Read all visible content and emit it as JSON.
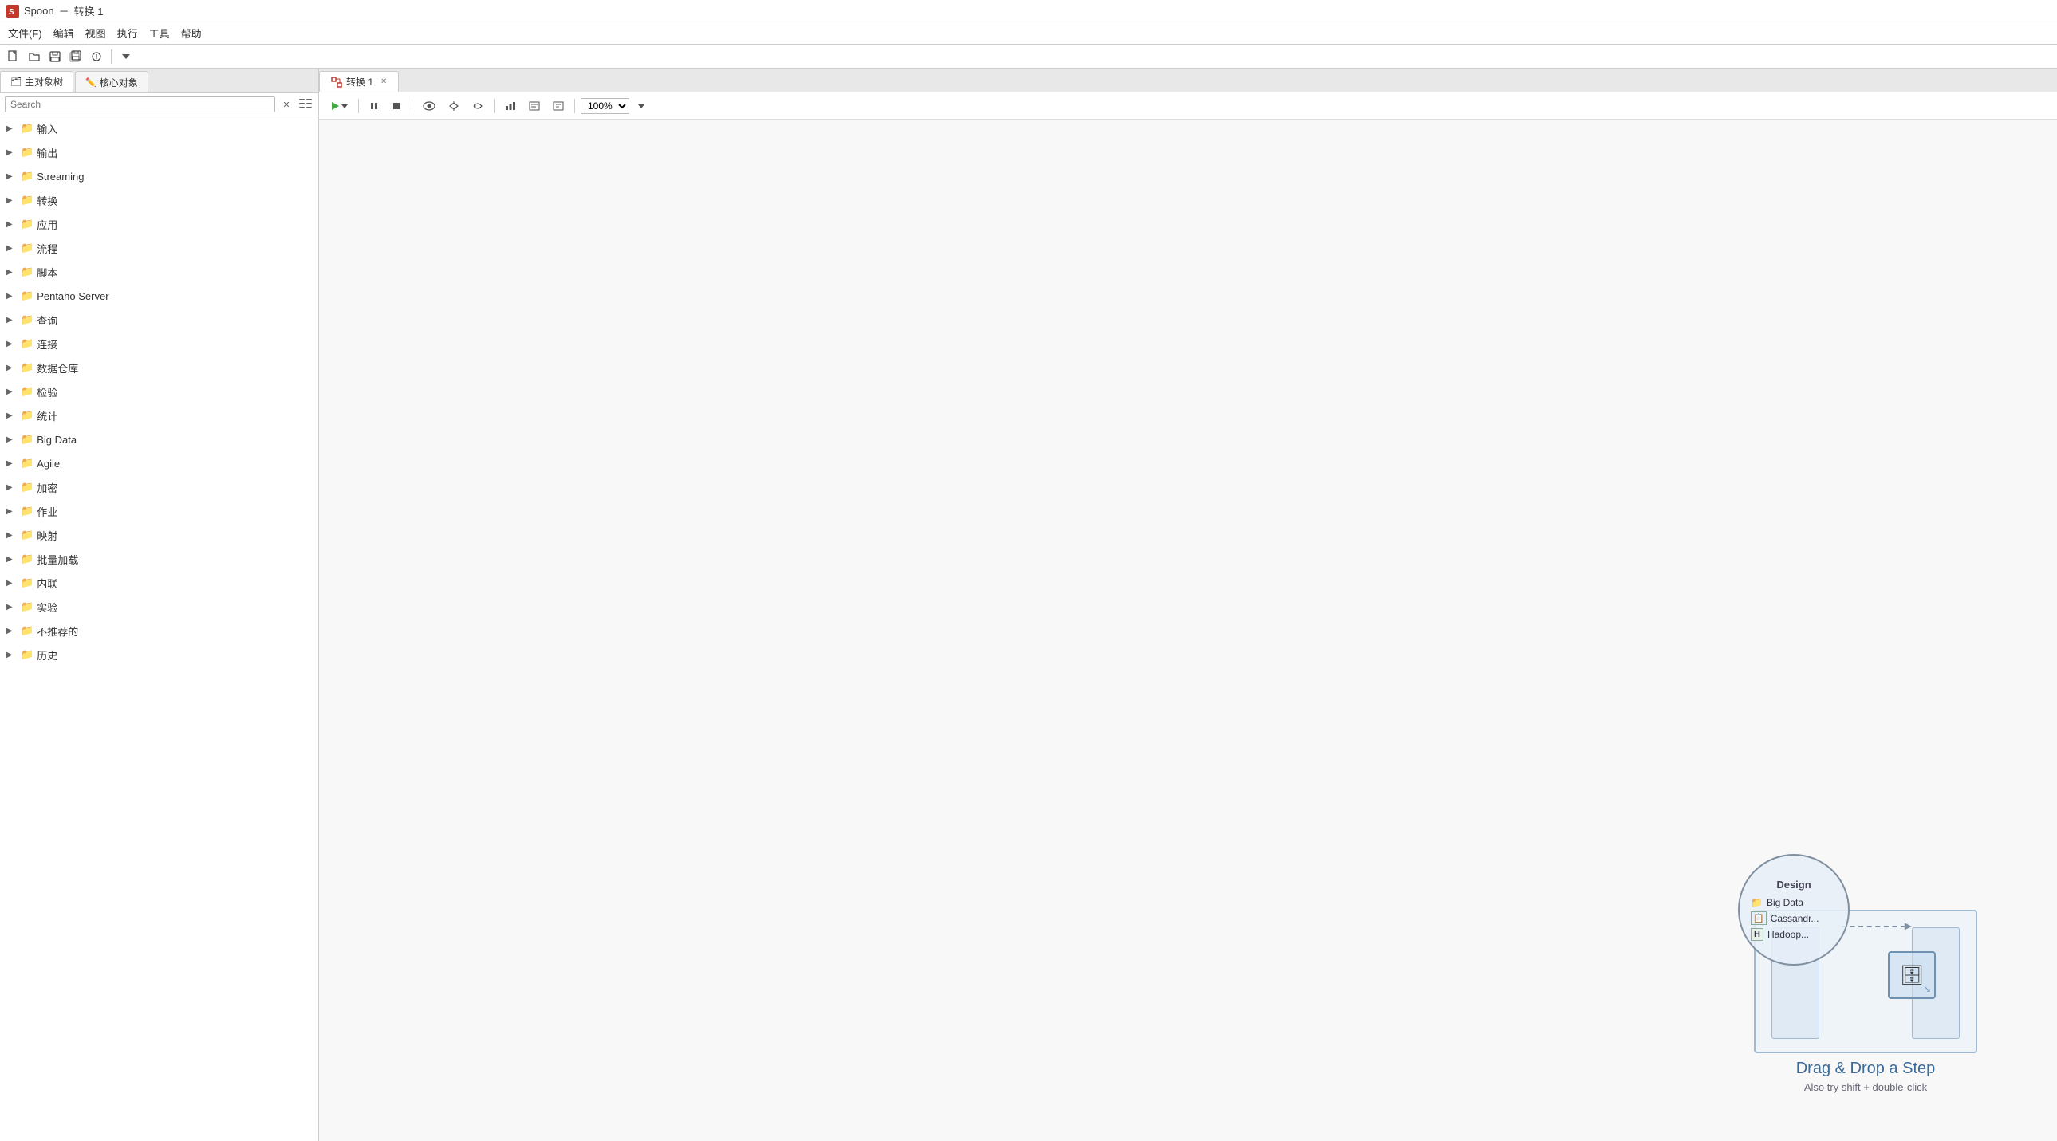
{
  "titleBar": {
    "appName": "Spoon",
    "separator": "－",
    "docName": "转换 1",
    "appIconColor": "#c0392b"
  },
  "menuBar": {
    "items": [
      {
        "label": "文件(F)"
      },
      {
        "label": "编辑"
      },
      {
        "label": "视图"
      },
      {
        "label": "执行"
      },
      {
        "label": "工具"
      },
      {
        "label": "帮助"
      }
    ]
  },
  "toolbar": {
    "buttons": [
      "📄",
      "📂",
      "💾",
      "🖨",
      "📋",
      "↩"
    ]
  },
  "leftPanel": {
    "tabs": [
      {
        "label": "主对象树",
        "icon": "🗂",
        "active": true
      },
      {
        "label": "核心对象",
        "icon": "✏️",
        "active": false
      }
    ],
    "search": {
      "placeholder": "Search",
      "clearBtn": "✕",
      "configBtn": "⚙"
    },
    "tree": [
      {
        "label": "输入",
        "arrow": "▶",
        "level": 0
      },
      {
        "label": "输出",
        "arrow": "▶",
        "level": 0
      },
      {
        "label": "Streaming",
        "arrow": "▶",
        "level": 0
      },
      {
        "label": "转换",
        "arrow": "▶",
        "level": 0
      },
      {
        "label": "应用",
        "arrow": "▶",
        "level": 0
      },
      {
        "label": "流程",
        "arrow": "▶",
        "level": 0
      },
      {
        "label": "脚本",
        "arrow": "▶",
        "level": 0
      },
      {
        "label": "Pentaho Server",
        "arrow": "▶",
        "level": 0
      },
      {
        "label": "查询",
        "arrow": "▶",
        "level": 0
      },
      {
        "label": "连接",
        "arrow": "▶",
        "level": 0
      },
      {
        "label": "数据仓库",
        "arrow": "▶",
        "level": 0
      },
      {
        "label": "检验",
        "arrow": "▶",
        "level": 0
      },
      {
        "label": "统计",
        "arrow": "▶",
        "level": 0
      },
      {
        "label": "Big Data",
        "arrow": "▶",
        "level": 0
      },
      {
        "label": "Agile",
        "arrow": "▶",
        "level": 0
      },
      {
        "label": "加密",
        "arrow": "▶",
        "level": 0
      },
      {
        "label": "作业",
        "arrow": "▶",
        "level": 0
      },
      {
        "label": "映射",
        "arrow": "▶",
        "level": 0
      },
      {
        "label": "批量加载",
        "arrow": "▶",
        "level": 0
      },
      {
        "label": "内联",
        "arrow": "▶",
        "level": 0
      },
      {
        "label": "实验",
        "arrow": "▶",
        "level": 0
      },
      {
        "label": "不推荐的",
        "arrow": "▶",
        "level": 0
      },
      {
        "label": "历史",
        "arrow": "▶",
        "level": 0
      }
    ]
  },
  "rightPanel": {
    "tabs": [
      {
        "label": "转换 1",
        "icon": "⚙",
        "active": true,
        "closable": true
      }
    ],
    "canvasToolbar": {
      "playBtn": "▶",
      "pauseBtn": "⏸",
      "stopBtn": "⏹",
      "eyeBtn": "👁",
      "moreBtn1": "⚡",
      "moreBtn2": "↻",
      "moreBtn3": "📊",
      "moreBtn4": "📋",
      "moreBtn5": "🖼",
      "zoomLabel": "100%"
    },
    "canvas": {
      "dndHint": {
        "circleTitle": "Design",
        "circleItems": [
          {
            "icon": "📁",
            "label": "Big Data"
          },
          {
            "icon": "📋",
            "label": "Cassandr..."
          },
          {
            "icon": "H",
            "label": "Hadoop..."
          }
        ],
        "dbIcon": "🗄",
        "title": "Drag & Drop a Step",
        "subtitle": "Also try shift + double-click"
      }
    }
  }
}
